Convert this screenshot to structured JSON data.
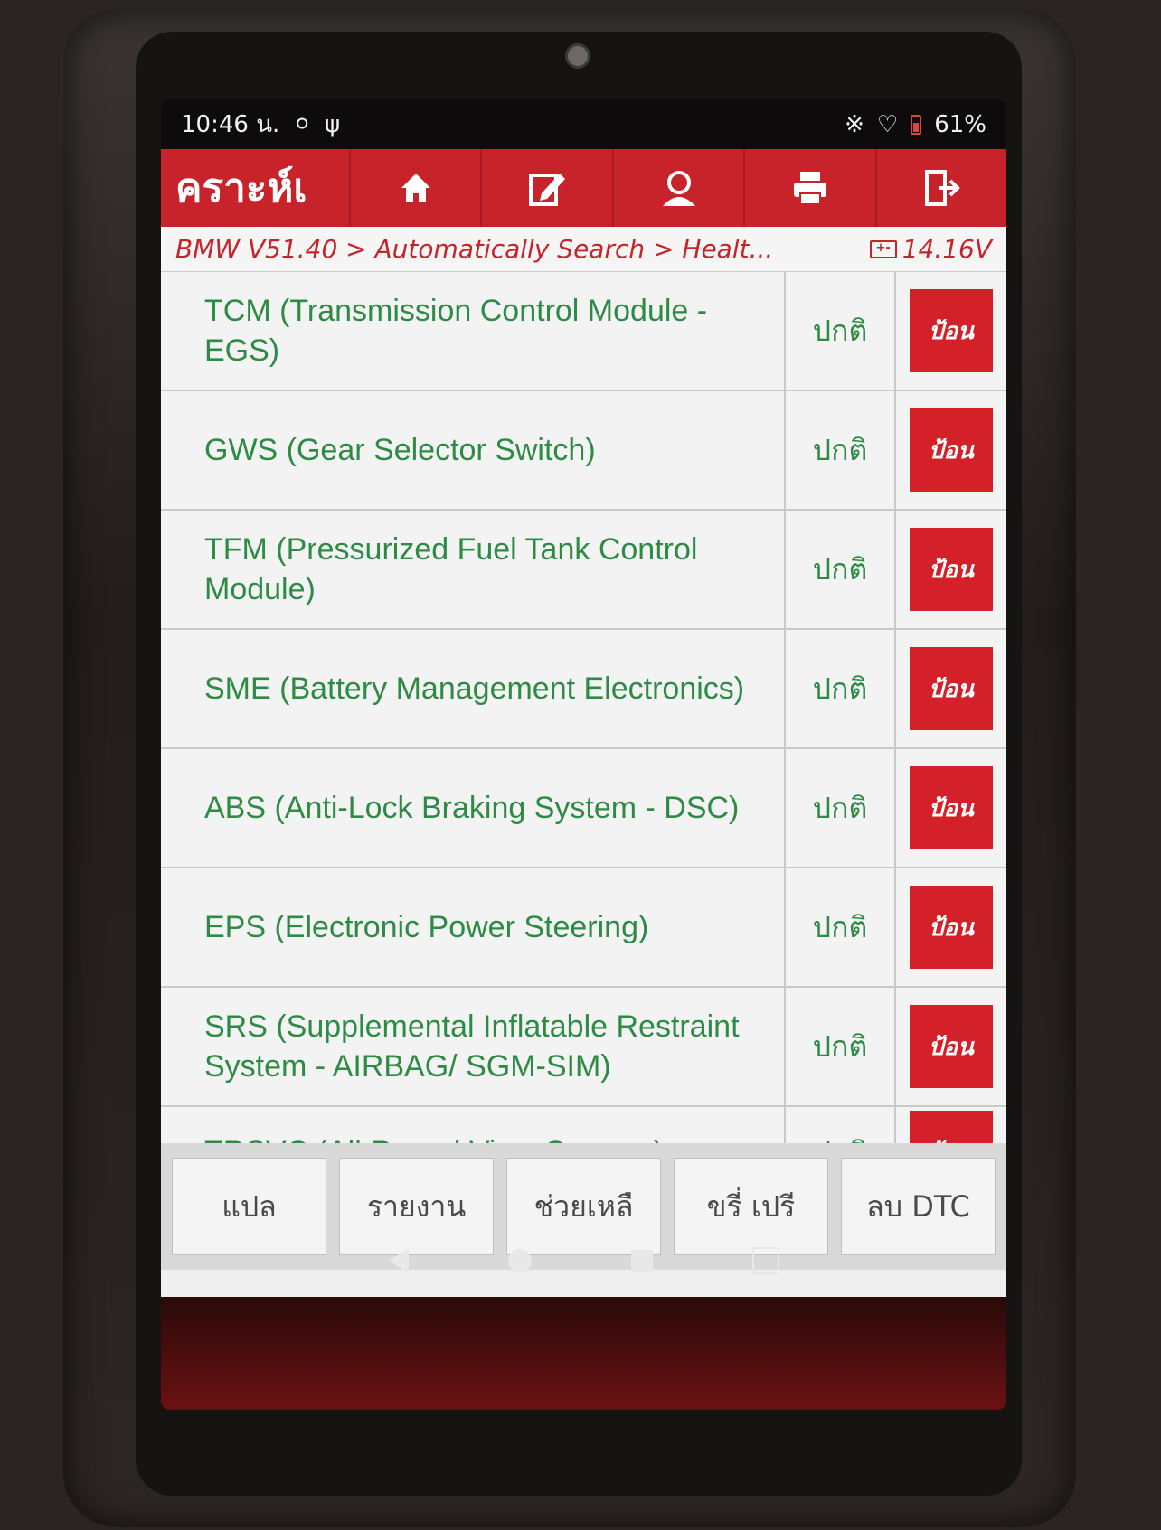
{
  "status_bar": {
    "time": "10:46 น.",
    "battery": "61%"
  },
  "app_bar": {
    "title": "คราะห์เ",
    "icons": [
      "home-icon",
      "edit-icon",
      "user-icon",
      "printer-icon",
      "exit-icon"
    ]
  },
  "breadcrumb": {
    "path": "BMW V51.40 > Automatically Search > Healt...",
    "voltage": "14.16V",
    "battery_glyph": "+-"
  },
  "modules": [
    {
      "name": "TCM (Transmission Control Module - EGS)",
      "status": "ปกติ",
      "action": "ป้อน"
    },
    {
      "name": "GWS (Gear Selector Switch)",
      "status": "ปกติ",
      "action": "ป้อน"
    },
    {
      "name": "TFM (Pressurized Fuel Tank Control Module)",
      "status": "ปกติ",
      "action": "ป้อน"
    },
    {
      "name": "SME (Battery Management Electronics)",
      "status": "ปกติ",
      "action": "ป้อน"
    },
    {
      "name": "ABS (Anti-Lock Braking System - DSC)",
      "status": "ปกติ",
      "action": "ป้อน"
    },
    {
      "name": "EPS (Electronic Power Steering)",
      "status": "ปกติ",
      "action": "ป้อน"
    },
    {
      "name": "SRS (Supplemental Inflatable Restraint System - AIRBAG/ SGM-SIM)",
      "status": "ปกติ",
      "action": "ป้อน"
    },
    {
      "name": "TRSVC (All Round View Camera)",
      "status": "ปกติ",
      "action": "ป้อน"
    }
  ],
  "bottom_buttons": [
    "แปล",
    "รายงาน",
    "ช่วยเหลื",
    "ขรี่ เปรี",
    "ลบ DTC"
  ],
  "colors": {
    "accent": "#c8232a",
    "text_green": "#2e8b45",
    "button_red": "#d42028"
  }
}
